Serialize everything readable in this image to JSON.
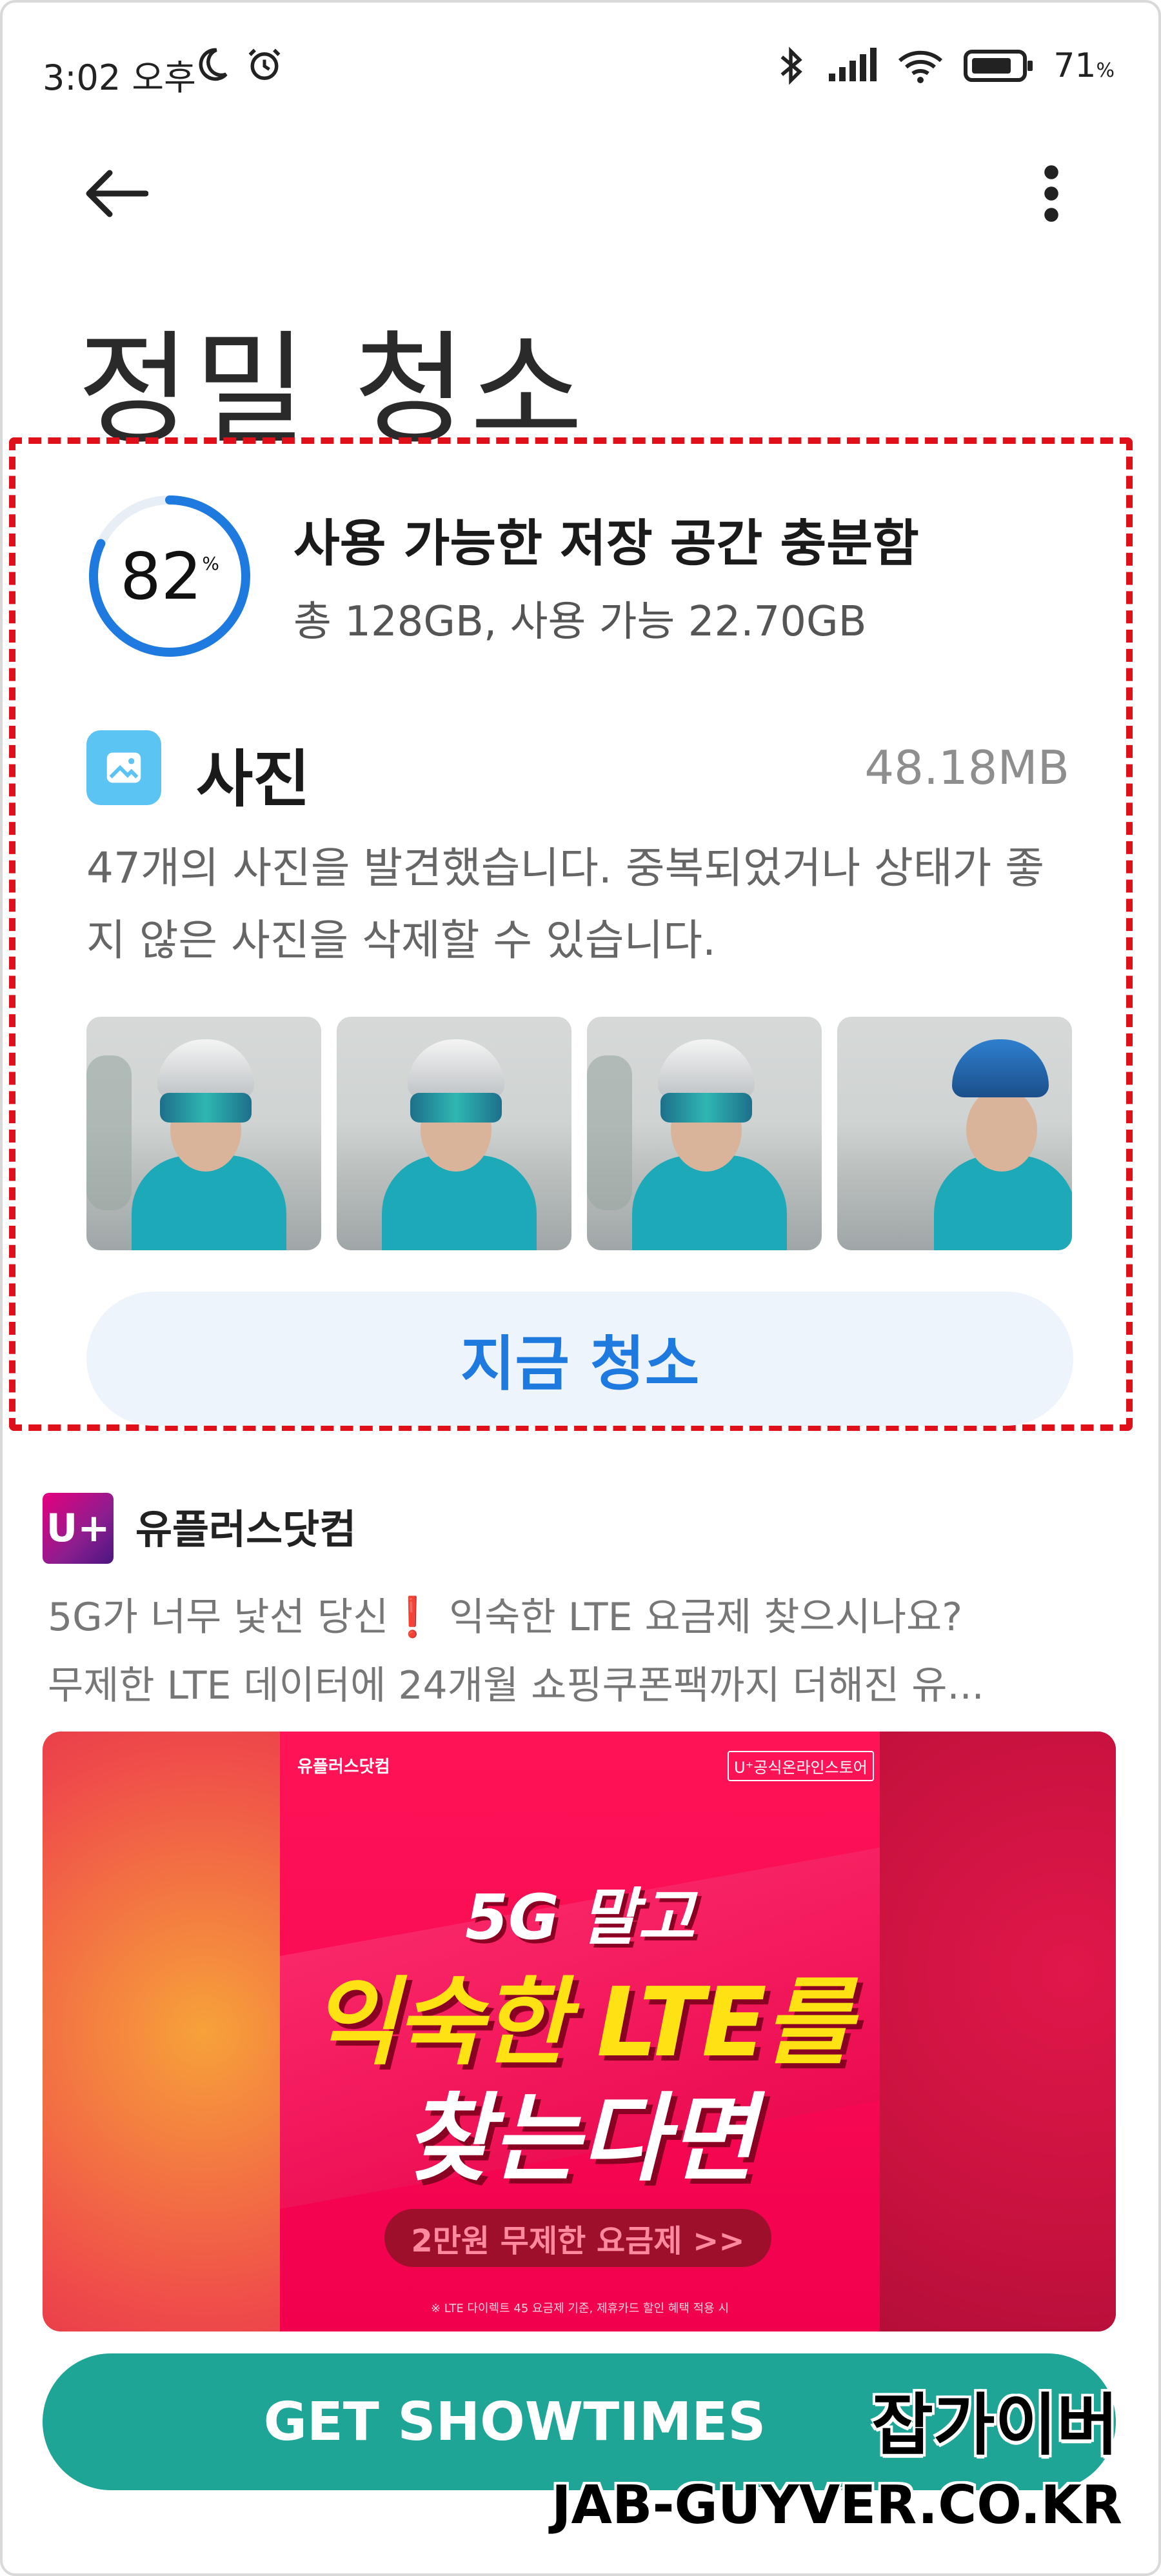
{
  "status_bar": {
    "time": "3:02 오후",
    "battery_percent": "71",
    "battery_unit": "%",
    "left_icons": [
      "moon-icon",
      "alarm-icon"
    ],
    "right_icons": [
      "bluetooth-icon",
      "signal-icon",
      "wifi-icon",
      "battery-icon"
    ]
  },
  "header": {
    "title": "정밀 청소"
  },
  "storage": {
    "used_percent": "82",
    "percent_sign": "%",
    "title": "사용 가능한 저장 공간 충분함",
    "subtitle": "총 128GB, 사용 가능 22.70GB",
    "ring_color": "#1f7ae0"
  },
  "photos": {
    "heading": "사진",
    "size": "48.18MB",
    "description": "47개의 사진을 발견했습니다. 중복되었거나 상태가 좋지 않은 사진을 삭제할 수 있습니다.",
    "clean_button": "지금 청소"
  },
  "ad": {
    "logo_text": "U+",
    "brand": "유플러스닷컴",
    "line1_a": "5G가 너무 낯선 당신",
    "line1_bang": "❗",
    "line1_b": " 익숙한 LTE 요금제 찾으시나요?",
    "line2": "무제한 LTE 데이터에  24개월 쇼핑쿠폰팩까지 더해진 유...",
    "banner": {
      "brand_small": "유플러스닷컴",
      "store_small": "U⁺공식온라인스토어",
      "headline1": "5G 말고",
      "headline2": "익숙한 LTE를",
      "headline3": "찾는다면",
      "pill": "2만원 무제한 요금제 >>",
      "fine_print": "※ LTE 다이렉트 45 요금제 기준, 제휴카드 할인 혜택 적용 시"
    },
    "cta": "GET SHOWTIMES"
  },
  "watermark": {
    "korean": "잡가이버",
    "english": "JAB-GUYVER.CO.KR"
  },
  "colors": {
    "accent_blue": "#1f7ae0",
    "highlight_red": "#e0101a",
    "cta_teal": "#1ea595"
  }
}
